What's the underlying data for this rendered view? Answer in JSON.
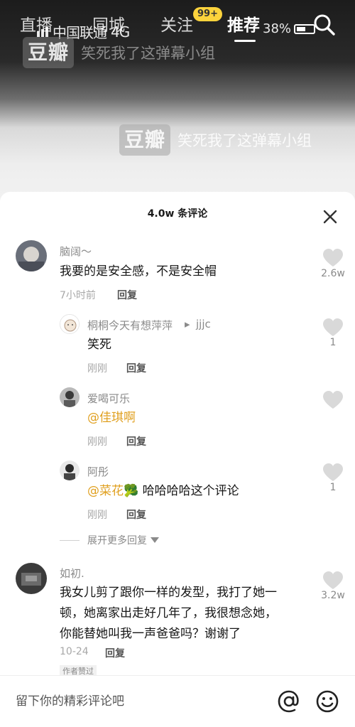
{
  "status_bar": {
    "carrier": "中国联通",
    "network": "4G",
    "battery": "38%"
  },
  "nav": {
    "tabs": [
      "直播",
      "同城",
      "关注",
      "推荐"
    ],
    "active_tab": "推荐",
    "badge": "99+",
    "search_icon": "search-icon"
  },
  "watermark": {
    "logo": "豆瓣",
    "text": "笑死我了这弹幕小组"
  },
  "sheet": {
    "title": "4.0w 条评论",
    "close_icon": "close-icon"
  },
  "comments": [
    {
      "user": "脑阔～",
      "text": "我要的是安全感，不是安全帽",
      "time": "7小时前",
      "reply": "回复",
      "likes": "2.6w"
    },
    {
      "user": "桐桐今天有想萍萍",
      "reply_to": "jjjc",
      "text": "笑死",
      "time": "刚刚",
      "reply": "回复",
      "likes": "1"
    },
    {
      "user": "爱喝可乐",
      "mention": "@佳琪啊",
      "text": "",
      "time": "刚刚",
      "reply": "回复",
      "likes": ""
    },
    {
      "user": "阿彤",
      "mention": "@菜花🥦",
      "text": "哈哈哈哈这个评论",
      "time": "刚刚",
      "reply": "回复",
      "likes": "1"
    },
    {
      "user": "如初.",
      "text_lines": [
        "我女儿剪了跟你一样的发型，我打了她一",
        "顿，她离家出走好几年了，我很想念她，",
        "你能替她叫我一声爸爸吗？谢谢了"
      ],
      "time": "10-24",
      "reply": "回复",
      "likes": "3.2w",
      "tag": "作者赞过"
    }
  ],
  "expand_more": "展开更多回复",
  "input": {
    "placeholder": "留下你的精彩评论吧",
    "at_icon": "at-icon",
    "emoji_icon": "emoji-icon"
  },
  "colors": {
    "mention": "#e0a020",
    "badge": "#fcd33c",
    "heart": "#d9d9d9"
  }
}
